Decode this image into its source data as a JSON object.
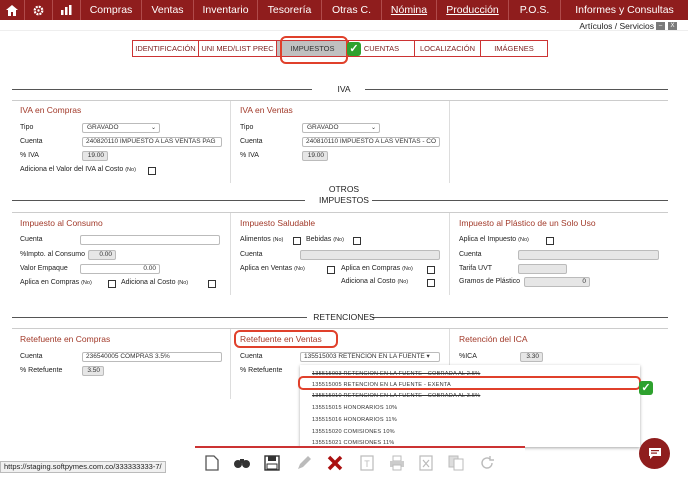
{
  "nav": {
    "compras": "Compras",
    "ventas": "Ventas",
    "inventario": "Inventario",
    "tesoreria": "Tesorería",
    "otros": "Otras C.",
    "nomina": "Nómina",
    "produccion": "Producción",
    "pos": "P.O.S.",
    "informes": "Informes y Consultas"
  },
  "header": {
    "subtitle": "Artículos / Servicios",
    "minimize": "–",
    "close": "X"
  },
  "tabs": [
    "IDENTIFICACIÓN",
    "UNI MED/LIST PREC",
    "IMPUESTOS",
    "CUENTAS",
    "LOCALIZACIÓN",
    "IMÁGENES"
  ],
  "sections": {
    "iva": "IVA",
    "otros_l1": "OTROS",
    "otros_l2": "IMPUESTOS",
    "retenciones": "RETENCIONES"
  },
  "iva_compras": {
    "title": "IVA en Compras",
    "tipo_label": "Tipo",
    "tipo_value": "GRAVADO",
    "cuenta_label": "Cuenta",
    "cuenta_value": "240820110 IMPUESTO A LAS VENTAS PAG",
    "piva_label": "% IVA",
    "piva_value": "19.00",
    "adiciona_label": "Adiciona el Valor del IVA al Costo",
    "adiciona_suffix": "(No)"
  },
  "iva_ventas": {
    "title": "IVA en Ventas",
    "tipo_label": "Tipo",
    "tipo_value": "GRAVADO",
    "cuenta_label": "Cuenta",
    "cuenta_value": "240810110 IMPUESTO A LAS VENTAS - CO",
    "piva_label": "% IVA",
    "piva_value": "19.00"
  },
  "consumo": {
    "title": "Impuesto al Consumo",
    "cuenta_label": "Cuenta",
    "pimpto_label": "%Impto. al Consumo",
    "pimpto_value": "0.00",
    "valor_label": "Valor Empaque",
    "valor_value": "0.00",
    "aplica_label": "Aplica en Compras",
    "aplica_suffix": "(No)",
    "adiciona_label": "Adiciona al Costo",
    "adiciona_suffix": "(No)"
  },
  "saludable": {
    "title": "Impuesto Saludable",
    "alimentos_label": "Alimentos",
    "alimentos_suffix": "(No)",
    "bebidas_label": "Bebidas",
    "bebidas_suffix": "(No)",
    "cuenta_label": "Cuenta",
    "aplica_ventas_label": "Aplica en Ventas",
    "aplica_ventas_suffix": "(No)",
    "aplica_compras_label": "Aplica en Compras",
    "aplica_compras_suffix": "(No)",
    "adiciona_label": "Adiciona al Costo",
    "adiciona_suffix": "(No)"
  },
  "plastico": {
    "title": "Impuesto al Plástico de un Solo Uso",
    "aplica_label": "Aplica el Impuesto",
    "aplica_suffix": "(No)",
    "cuenta_label": "Cuenta",
    "tarifa_label": "Tarifa UVT",
    "gramos_label": "Gramos de Plástico",
    "gramos_value": "0"
  },
  "retefuente_compras": {
    "title": "Retefuente en Compras",
    "cuenta_label": "Cuenta",
    "cuenta_value": "236540005 COMPRAS 3.5%",
    "pret_label": "% Retefuente",
    "pret_value": "3.50"
  },
  "retefuente_ventas": {
    "title": "Retefuente en Ventas",
    "cuenta_label": "Cuenta",
    "cuenta_value": "135515003 RETENCION EN LA FUENTE ▾",
    "pret_label": "% Retefuente"
  },
  "reteica": {
    "title": "Retención del ICA",
    "pica_label": "%ICA",
    "pica_value": "3.30"
  },
  "dropdown": [
    "135515003 RETENCION EN LA FUENTE - COBRADA AL 2.5%",
    "135515005 RETENCION EN LA FUENTE - EXENTA",
    "135515010 RETENCION EN LA FUENTE - COBRADA AL 3.5%",
    "135515015 HONORARIOS 10%",
    "135515016 HONORARIOS 11%",
    "135515020 COMISIONES 10%",
    "135515021 COMISIONES 11%"
  ],
  "status_url": "https://staging.softpymes.com.co/333333333-7/",
  "colors": {
    "brand": "#8f1d1d",
    "accent": "#e0402b",
    "panel_title": "#a23a2a",
    "check": "#2ea12e"
  }
}
